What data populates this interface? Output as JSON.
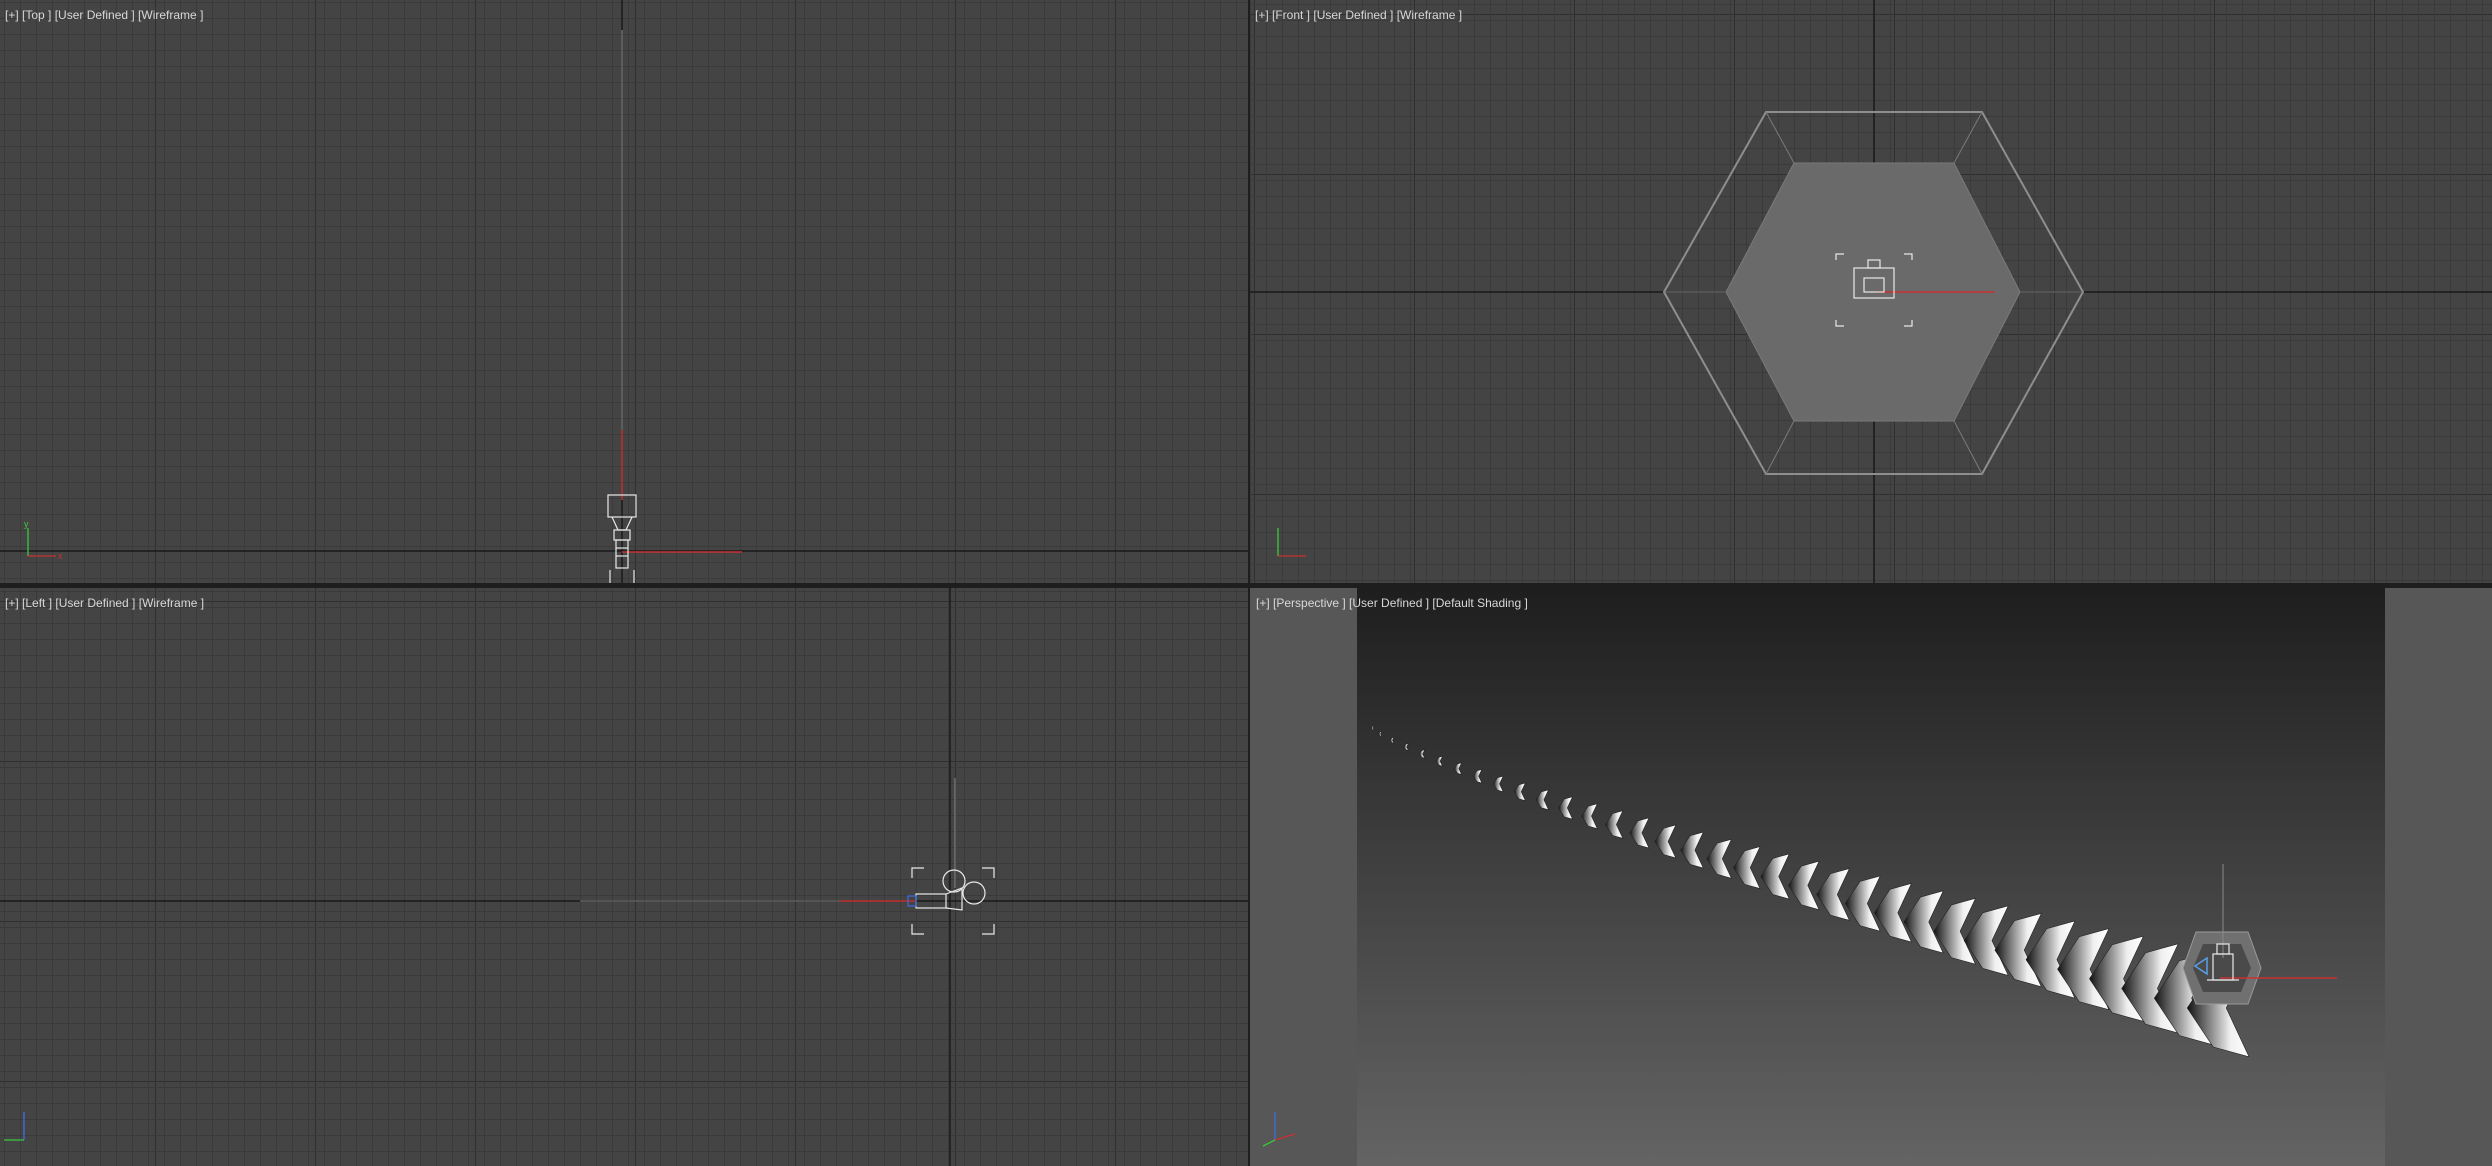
{
  "viewports": {
    "top": {
      "label": "[+] [Top ] [User Defined ] [Wireframe ]"
    },
    "front": {
      "label": "[+] [Front ] [User Defined ] [Wireframe ]"
    },
    "left": {
      "label": "[+] [Left ] [User Defined ] [Wireframe ]"
    },
    "perspective": {
      "label": "[+] [Perspective ] [User Defined ] [Default Shading ]",
      "active": true
    }
  },
  "colors": {
    "viewport_bg": "#444444",
    "grid_minor": "#3a3a3a",
    "grid_major": "#2f2f2f",
    "active_border": "#b4a77a",
    "axis_x": "#c83232",
    "axis_y": "#3cc83c",
    "axis_z": "#3c6ee6"
  },
  "icons": [
    "axis-tripod-icon",
    "camera-gizmo-icon",
    "light-target-icon"
  ]
}
